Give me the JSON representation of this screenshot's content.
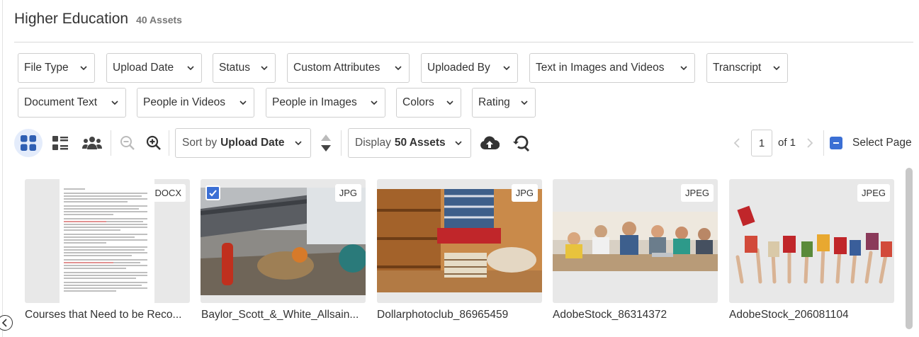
{
  "header": {
    "title": "Higher Education",
    "count": "40 Assets"
  },
  "filters": {
    "file_type": "File Type",
    "upload_date": "Upload Date",
    "status": "Status",
    "custom_attributes": "Custom Attributes",
    "uploaded_by": "Uploaded By",
    "text_in_images": "Text in Images and Videos",
    "transcript": "Transcript",
    "document_text": "Document Text",
    "people_in_videos": "People in Videos",
    "people_in_images": "People in Images",
    "colors": "Colors",
    "rating": "Rating"
  },
  "toolbar": {
    "sort_prefix": "Sort by",
    "sort_value": "Upload Date",
    "display_prefix": "Display",
    "display_value": "50 Assets"
  },
  "pagination": {
    "page": "1",
    "of_label": "of 1",
    "select_page": "Select Page"
  },
  "assets": [
    {
      "name": "Courses that Need to be Reco...",
      "type": "DOCX",
      "selected": false
    },
    {
      "name": "Baylor_Scott_&_White_Allsain...",
      "type": "JPG",
      "selected": true
    },
    {
      "name": "Dollarphotoclub_86965459",
      "type": "JPG",
      "selected": false
    },
    {
      "name": "AdobeStock_86314372",
      "type": "JPEG",
      "selected": false
    },
    {
      "name": "AdobeStock_206081104",
      "type": "JPEG",
      "selected": false
    }
  ],
  "colors": {
    "accent": "#3b6fd4",
    "grid_icon": "#2f5fb3",
    "text": "#333333"
  }
}
